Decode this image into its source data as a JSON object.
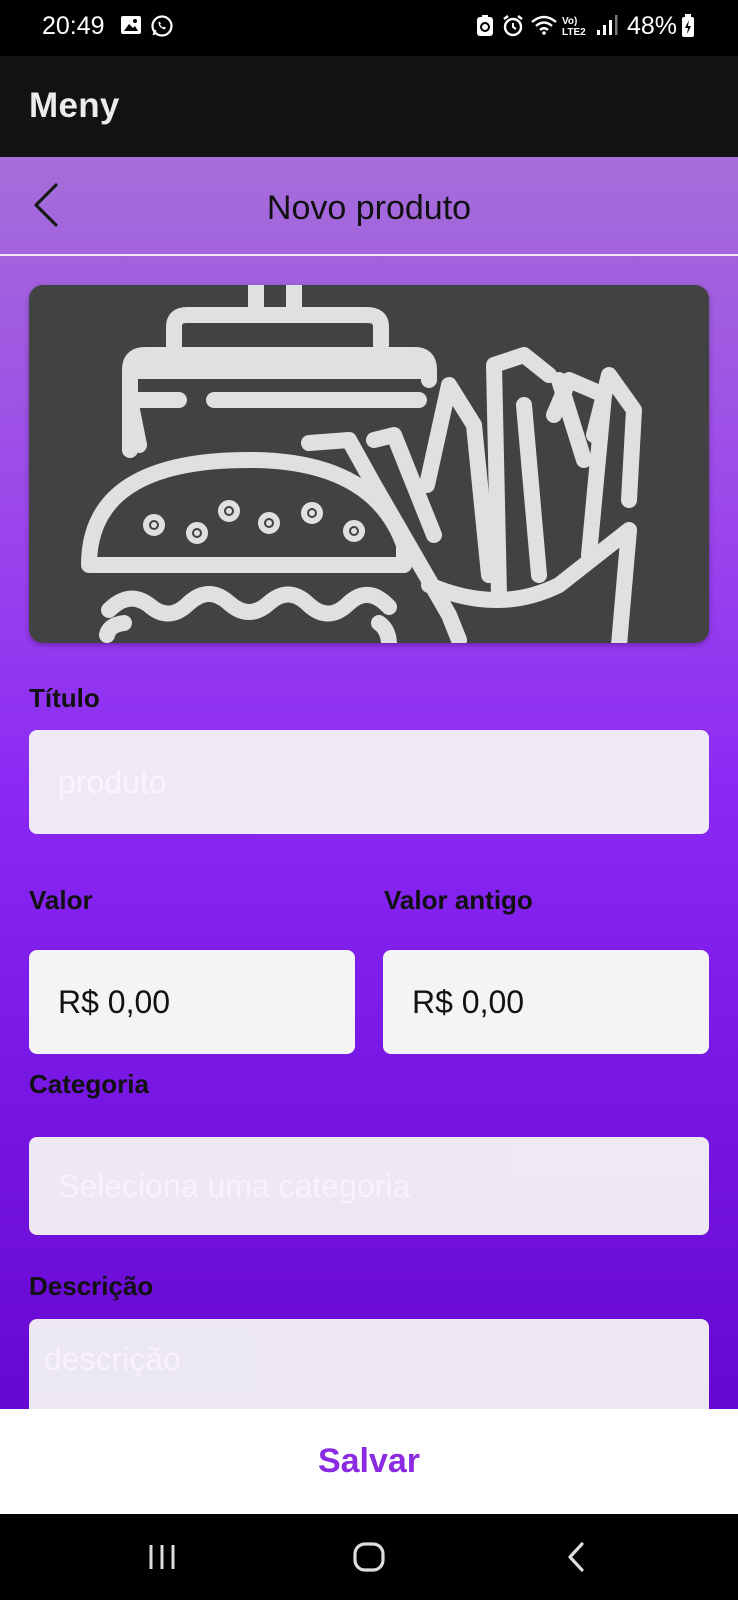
{
  "status_bar": {
    "time": "20:49",
    "battery_percent": "48%",
    "network_label": "Vo) LTE2",
    "icons": [
      "gallery-icon",
      "whatsapp-icon",
      "data-saver-icon",
      "alarm-icon",
      "wifi-icon",
      "signal-icon",
      "battery-icon"
    ]
  },
  "app_bar": {
    "title": "Meny"
  },
  "header": {
    "title": "Novo produto",
    "back_icon": "chevron-left-icon"
  },
  "product_image": {
    "icon": "fast-food-illustration"
  },
  "form": {
    "title": {
      "label": "Título",
      "value": "",
      "placeholder": "produto"
    },
    "price": {
      "label": "Valor",
      "value": "R$ 0,00"
    },
    "old_price": {
      "label": "Valor antigo",
      "value": "R$ 0,00"
    },
    "category": {
      "label": "Categoria",
      "value": "",
      "placeholder": "Seleciona uma categoria"
    },
    "description": {
      "label": "Descrição",
      "value": "",
      "placeholder": "descrição"
    }
  },
  "actions": {
    "save_label": "Salvar"
  },
  "nav_bar": {
    "icons": [
      "recent-apps-icon",
      "home-icon",
      "back-icon"
    ]
  },
  "colors": {
    "accent": "#8a2be2",
    "gradient_top": "#a56ed9",
    "gradient_bottom": "#6608d0",
    "field_background": "#f4f4f4",
    "image_background": "#424242"
  }
}
